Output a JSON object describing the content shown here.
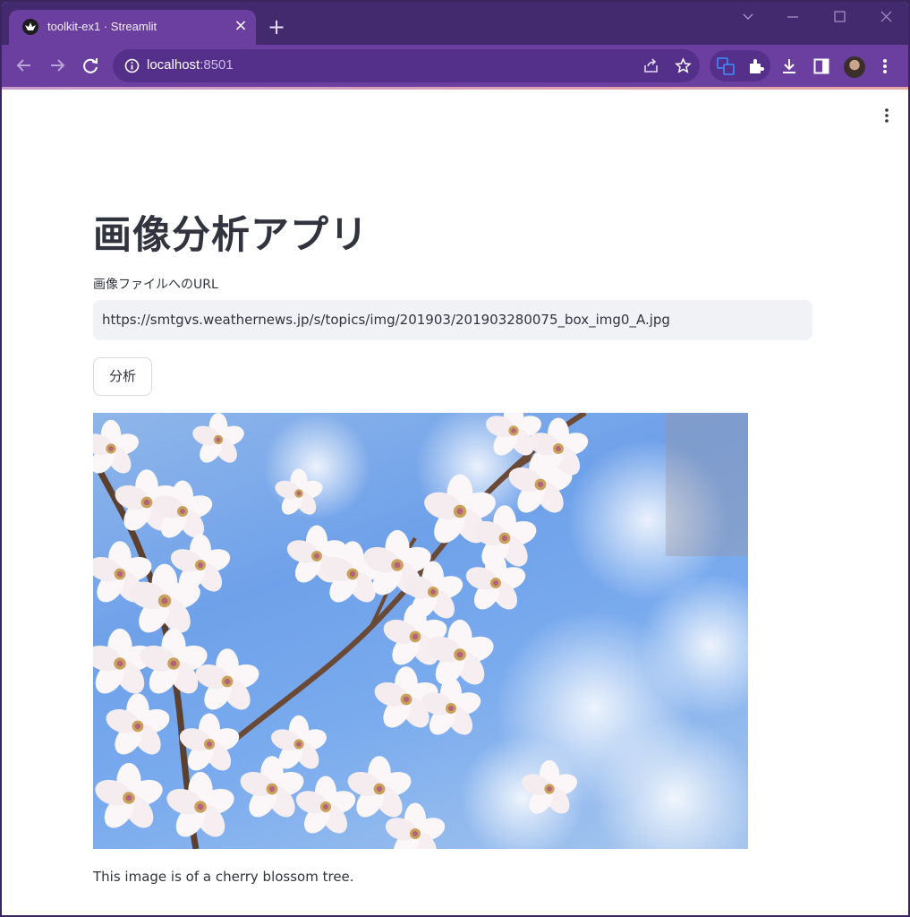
{
  "browser": {
    "tab_title": "toolkit-ex1 · Streamlit",
    "url_host": "localhost",
    "url_port": ":8501"
  },
  "app": {
    "title": "画像分析アプリ",
    "input_label": "画像ファイルへのURL",
    "input_value": "https://smtgvs.weathernews.jp/s/topics/img/201903/201903280075_box_img0_A.jpg",
    "analyze_button": "分析",
    "result_text": "This image is of a cherry blossom tree."
  },
  "colors": {
    "browser_frame": "#432a6e",
    "browser_toolbar": "#6b3fa0",
    "title_text": "#31333f",
    "input_bg": "#f0f2f6"
  },
  "icons": [
    "back-icon",
    "forward-icon",
    "reload-icon",
    "info-icon",
    "share-icon",
    "star-icon",
    "translate-icon",
    "extensions-icon",
    "download-icon",
    "side-panel-icon",
    "menu-icon"
  ]
}
